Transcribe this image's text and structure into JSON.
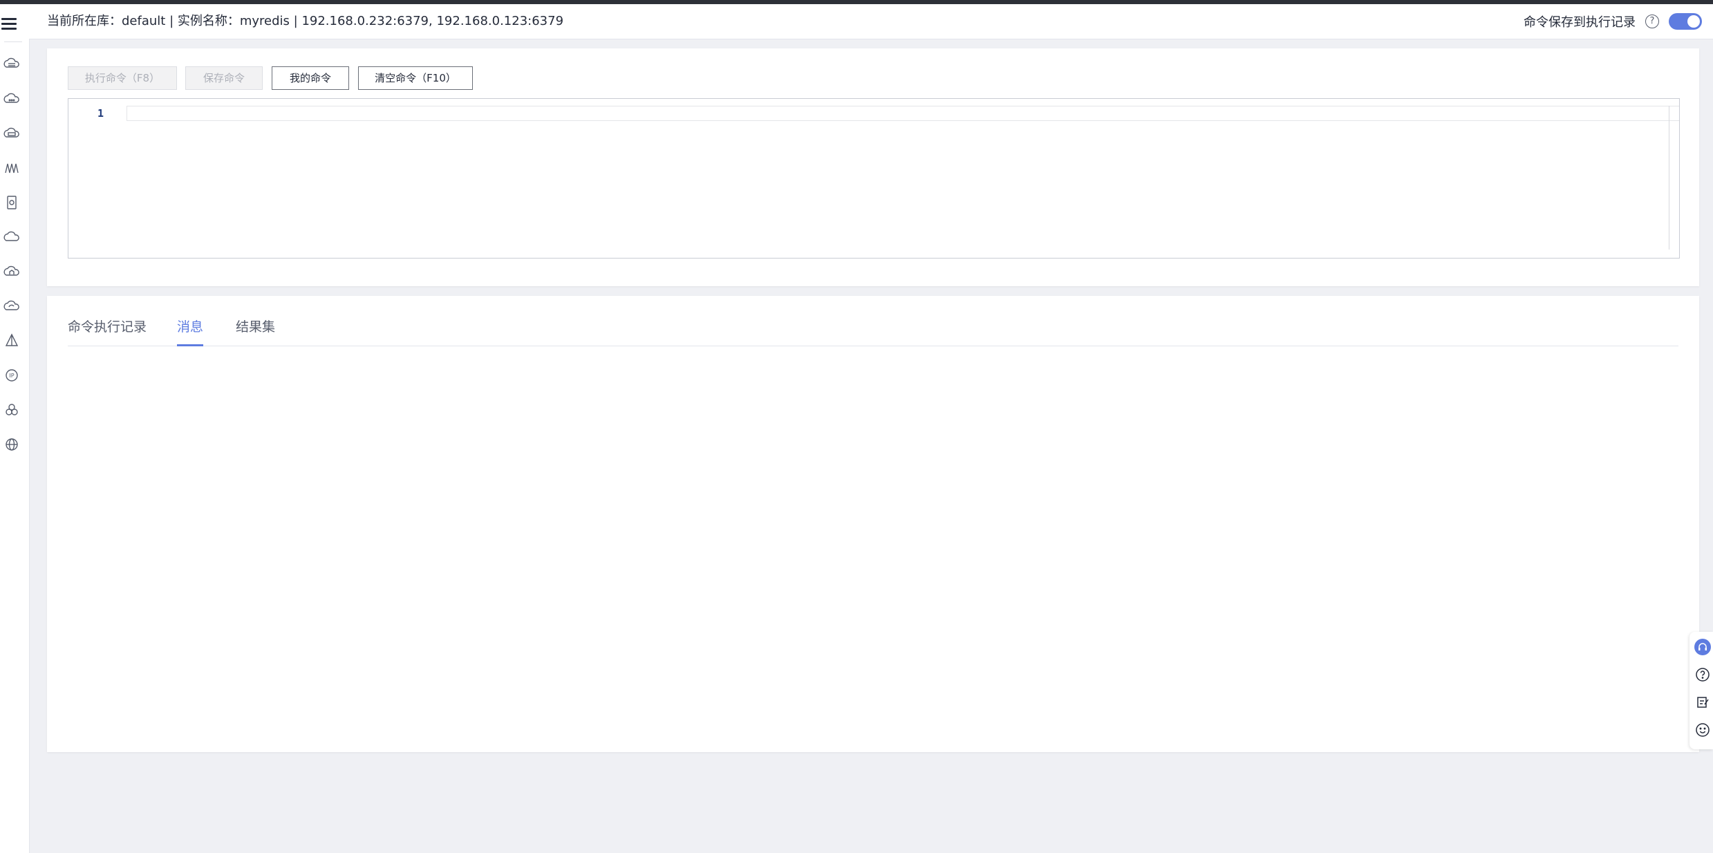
{
  "header": {
    "db_label": "当前所在库：",
    "db_value": "default",
    "separator": " | ",
    "instance_label": "实例名称：",
    "instance_value": "myredis",
    "separator2": " | ",
    "addresses": "192.168.0.232:6379, 192.168.0.123:6379",
    "save_history_label": "命令保存到执行记录",
    "help_glyph": "?"
  },
  "toolbar": {
    "execute_label": "执行命令（F8）",
    "save_label": "保存命令",
    "my_commands_label": "我的命令",
    "clear_label": "清空命令（F10）"
  },
  "editor": {
    "line_numbers": [
      "1"
    ],
    "content": ""
  },
  "tabs": [
    {
      "label": "命令执行记录",
      "active": false
    },
    {
      "label": "消息",
      "active": true
    },
    {
      "label": "结果集",
      "active": false
    }
  ],
  "sidebar": {
    "icons": [
      "cloud-database-icon",
      "cloud-icon",
      "cloud-server-icon",
      "cluster-icon",
      "document-icon",
      "cloud-outline-icon",
      "cloud-home-icon",
      "cloud-sync-icon",
      "triangle-icon",
      "ip-icon",
      "circles-icon",
      "globe-icon"
    ]
  },
  "float_tools": [
    "headset-icon",
    "question-icon",
    "edit-note-icon",
    "smiley-icon"
  ],
  "colors": {
    "accent": "#5e7ce0",
    "page_bg": "#eff0f4",
    "text": "#252b3a"
  }
}
